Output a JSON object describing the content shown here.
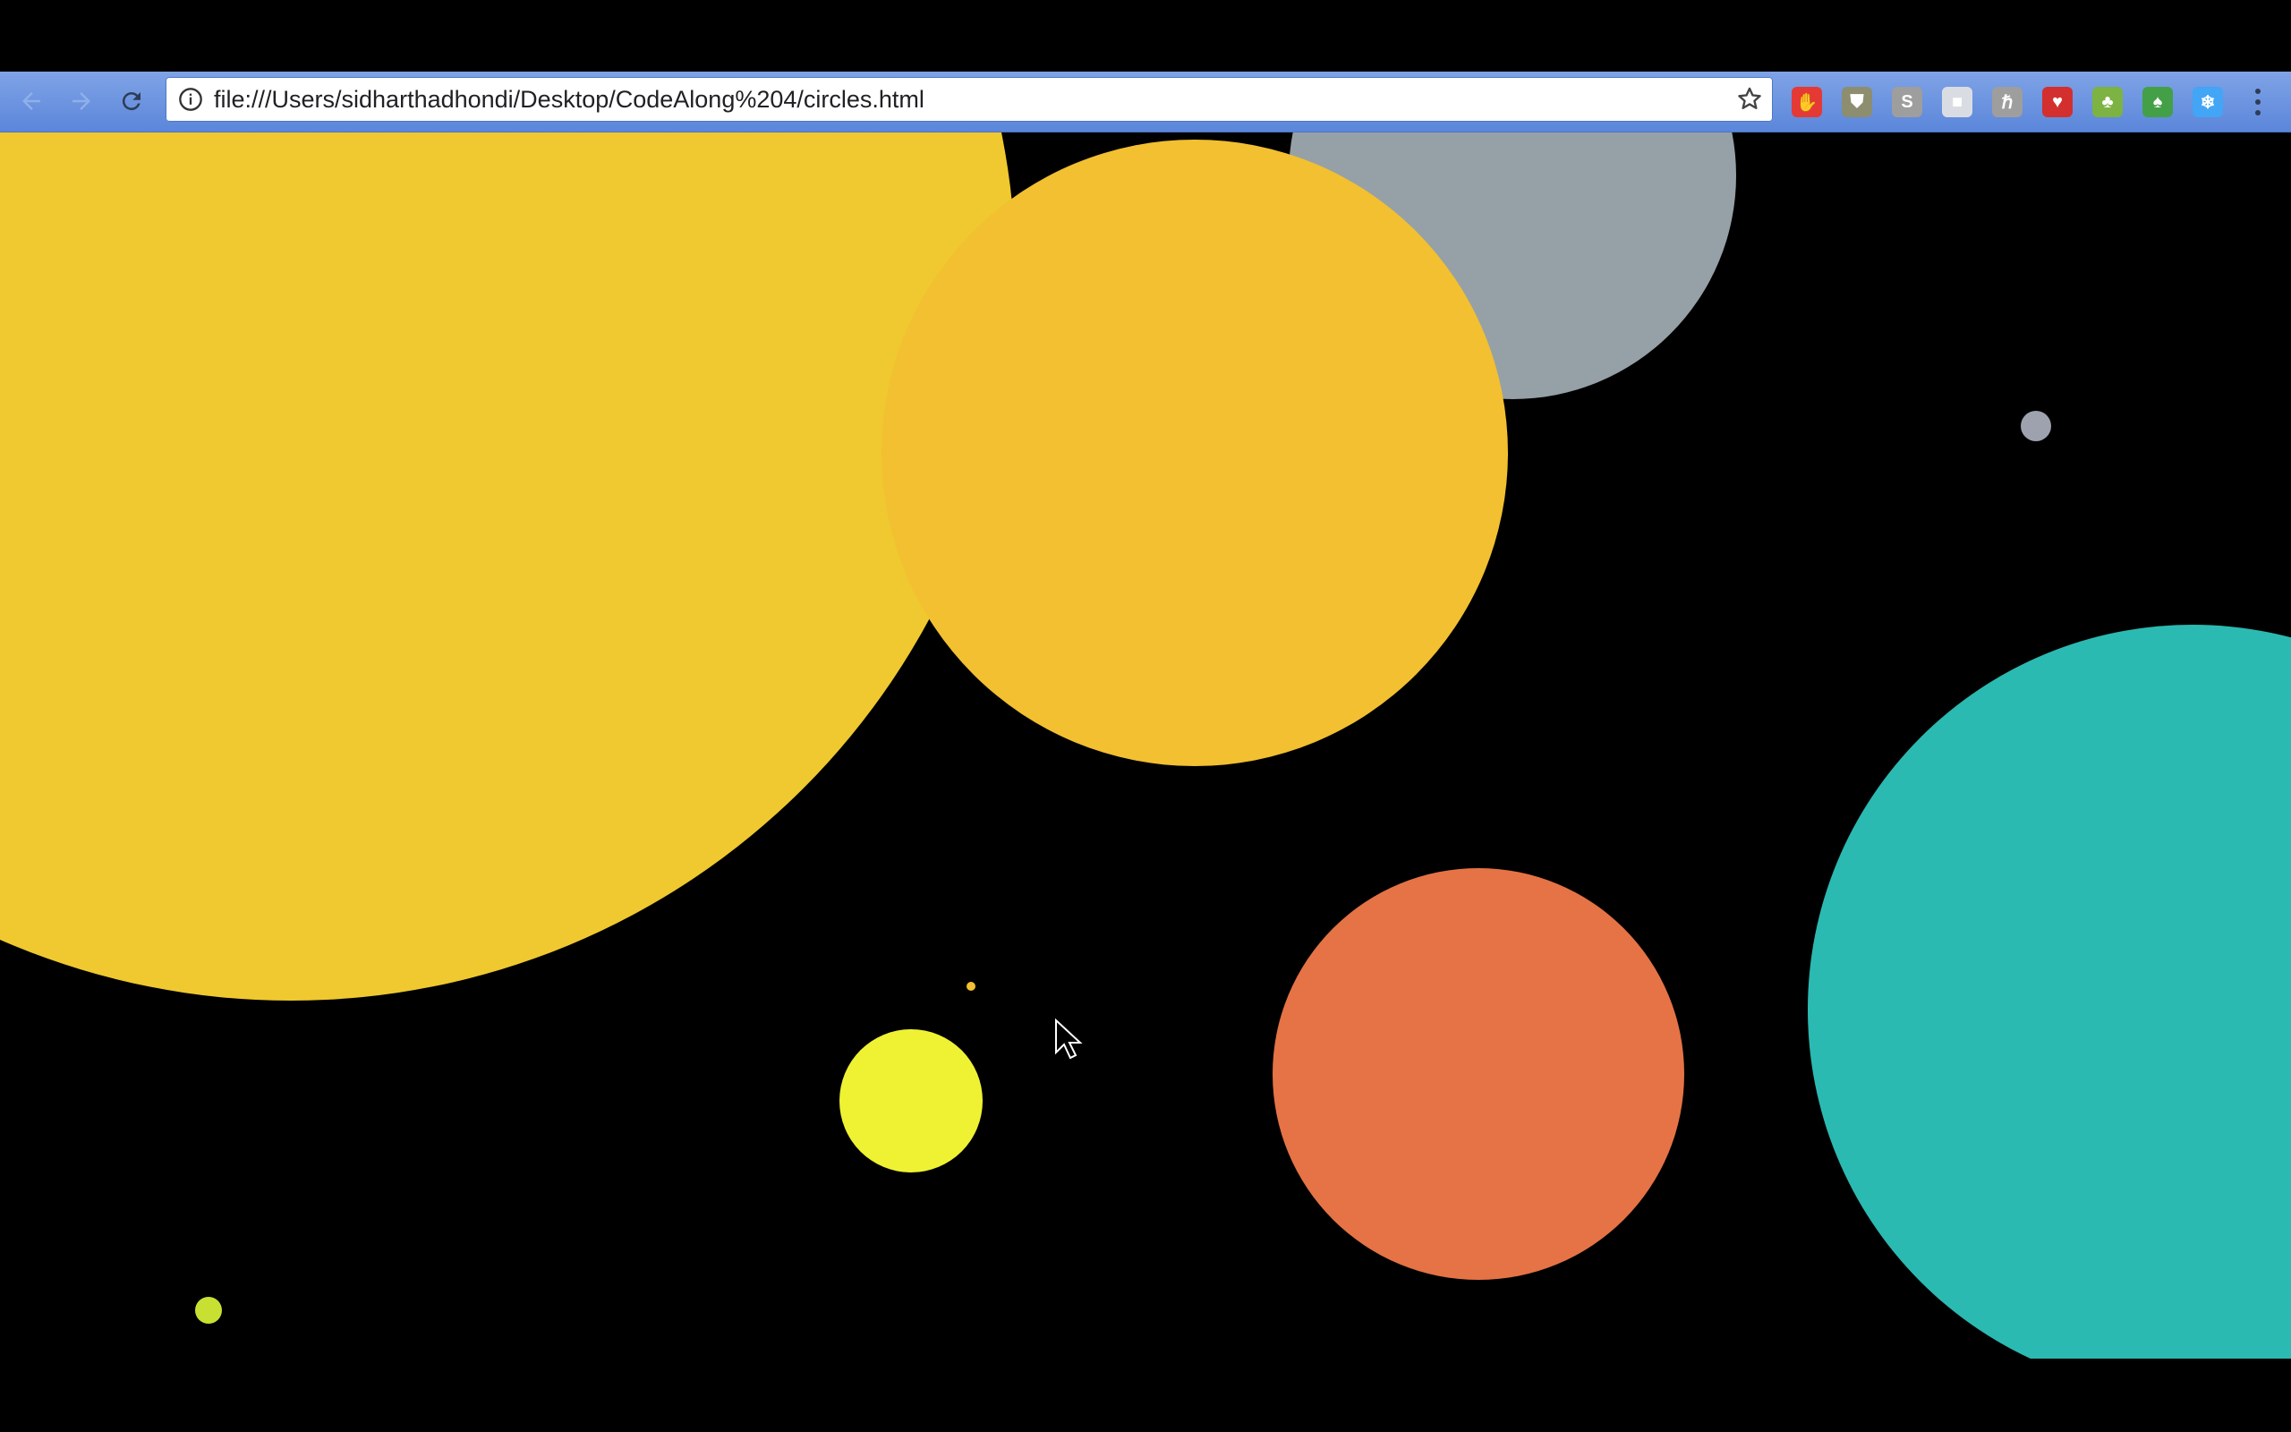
{
  "browser": {
    "url": "file:///Users/sidharthadhondi/Desktop/CodeAlong%204/circles.html",
    "nav": [
      "back-icon",
      "forward-icon",
      "reload-icon"
    ],
    "extensions": [
      {
        "name": "adblock-extension-icon",
        "color": "#e53935",
        "glyph": "✋"
      },
      {
        "name": "shield-extension-icon",
        "color": "#8d8d6f",
        "glyph": "⛊"
      },
      {
        "name": "skype-extension-icon",
        "color": "#9e9e9e",
        "glyph": "S"
      },
      {
        "name": "cube-extension-icon",
        "color": "#d9dde3",
        "glyph": "■"
      },
      {
        "name": "h-extension-icon",
        "color": "#9e9e9e",
        "glyph": "ℏ"
      },
      {
        "name": "red-shield-extension-icon",
        "color": "#d32f2f",
        "glyph": "♥"
      },
      {
        "name": "sprout-extension-icon",
        "color": "#7cb342",
        "glyph": "♣"
      },
      {
        "name": "tree-extension-icon",
        "color": "#43a047",
        "glyph": "♠"
      },
      {
        "name": "snowflake-extension-icon",
        "color": "#42a5f5",
        "glyph": "❄"
      }
    ]
  },
  "circles": [
    {
      "name": "large-yellow-circle",
      "color": "#efc92f"
    },
    {
      "name": "gray-circle",
      "color": "#96a1a7"
    },
    {
      "name": "orange-yellow-circle",
      "color": "#f2c030"
    },
    {
      "name": "teal-circle",
      "color": "#2bbab2"
    },
    {
      "name": "orange-circle",
      "color": "#e57346"
    },
    {
      "name": "bright-yellow-circle",
      "color": "#eef233"
    },
    {
      "name": "small-gray-dot",
      "color": "#9ea2ae"
    },
    {
      "name": "tiny-yellow-dot",
      "color": "#f2c030"
    },
    {
      "name": "small-lime-dot",
      "color": "#c8e032"
    }
  ]
}
